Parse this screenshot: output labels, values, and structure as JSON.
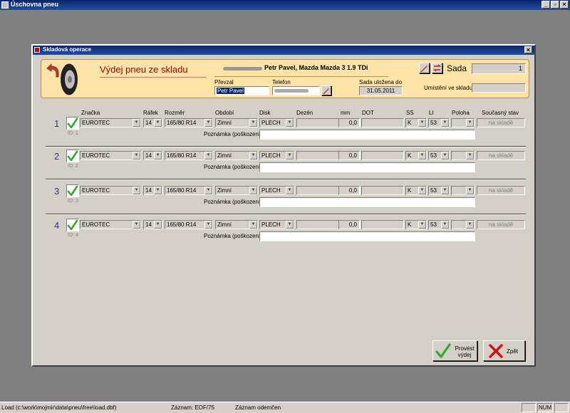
{
  "window": {
    "title": "Úschovna pneu"
  },
  "dialog": {
    "title": "Skladová operace"
  },
  "header": {
    "operation_title": "Výdej pneu ze skladu",
    "customer": "Petr Pavel, Mazda Mazda 3 1.9 TDi",
    "prevzal_label": "Převzal",
    "prevzal_value": "Petr Pavel",
    "telefon_label": "Telefon",
    "sada_ulozena_label": "Sada uložena do",
    "sada_ulozena_value": "31.05.2011",
    "sada_label": "Sada",
    "sada_value": "1",
    "umisteni_label": "Umístění ve skladu",
    "umisteni_value": ""
  },
  "columns": {
    "znacka": "Značka",
    "rafek": "Ráfek",
    "rozmer": "Rozměr",
    "obdobi": "Období",
    "disk": "Disk",
    "dezen": "Dezén",
    "mm": "mm",
    "dot": "DOT",
    "ss": "SS",
    "li": "LI",
    "poloha": "Poloha",
    "stav": "Současný stav"
  },
  "note_label": "Poznámka (poškození)",
  "rows": [
    {
      "num": "1",
      "id": "ID: 1",
      "znacka": "EUROTEC",
      "rafek": "14",
      "rozmer": "165/80 R14",
      "obdobi": "Zimní",
      "disk": "PLECH",
      "dezen": "",
      "mm": "0,0",
      "dot": "",
      "ss": "K",
      "li": "53",
      "poloha": "",
      "stav": "na skladě",
      "note": ""
    },
    {
      "num": "2",
      "id": "ID: 2",
      "znacka": "EUROTEC",
      "rafek": "14",
      "rozmer": "165/80 R14",
      "obdobi": "Zimní",
      "disk": "PLECH",
      "dezen": "",
      "mm": "0,0",
      "dot": "",
      "ss": "K",
      "li": "53",
      "poloha": "",
      "stav": "na skladě",
      "note": ""
    },
    {
      "num": "3",
      "id": "ID: 3",
      "znacka": "EUROTEC",
      "rafek": "14",
      "rozmer": "165/80 R14",
      "obdobi": "Zimní",
      "disk": "PLECH",
      "dezen": "",
      "mm": "0,0",
      "dot": "",
      "ss": "K",
      "li": "53",
      "poloha": "",
      "stav": "na skladě",
      "note": ""
    },
    {
      "num": "4",
      "id": "ID: 4",
      "znacka": "EUROTEC",
      "rafek": "14",
      "rozmer": "165/80 R14",
      "obdobi": "Zimní",
      "disk": "PLECH",
      "dezen": "",
      "mm": "0,0",
      "dot": "",
      "ss": "K",
      "li": "53",
      "poloha": "",
      "stav": "na skladě",
      "note": ""
    }
  ],
  "buttons": {
    "provest": "Provést výdej",
    "zpet": "Zpět"
  },
  "statusbar": {
    "load": "Load (c:\\work\\mojmir\\data\\pneu\\free\\load.dbf)",
    "zaznam": "Záznam: EOF/75",
    "odemcen": "Záznam odemčen",
    "num": "NUM"
  },
  "icons": [
    "app-icon",
    "back-arrow-icon",
    "tire-icon",
    "pen-icon",
    "swap-icon",
    "checkmark-icon",
    "cross-icon"
  ],
  "colors": {
    "header_bg": "#fde3a5",
    "title_red": "#990000",
    "row_num_blue": "#1f3c8a",
    "check_green": "#2faa2f",
    "cross_red": "#cc1111"
  }
}
